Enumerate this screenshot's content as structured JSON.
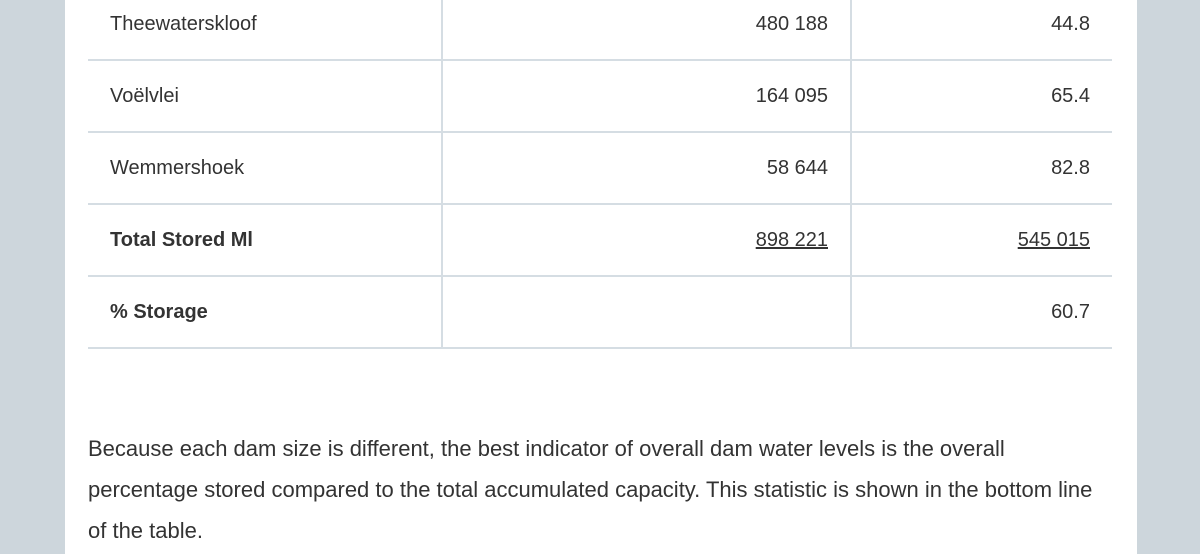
{
  "table": {
    "rows": [
      {
        "name": "Theewaterskloof",
        "capacity": "480 188",
        "percent": "44.8"
      },
      {
        "name": "Voëlvlei",
        "capacity": "164 095",
        "percent": "65.4"
      },
      {
        "name": "Wemmershoek",
        "capacity": "58 644",
        "percent": "82.8"
      },
      {
        "name": "Total Stored Ml",
        "capacity": "898 221",
        "percent": "545 015"
      },
      {
        "name": "% Storage",
        "capacity": "",
        "percent": "60.7"
      }
    ]
  },
  "paragraph": "Because each dam size is different, the best indicator of overall dam water levels is the overall percentage stored compared to the total accumulated capacity. This statistic is shown in the bottom line of the table."
}
